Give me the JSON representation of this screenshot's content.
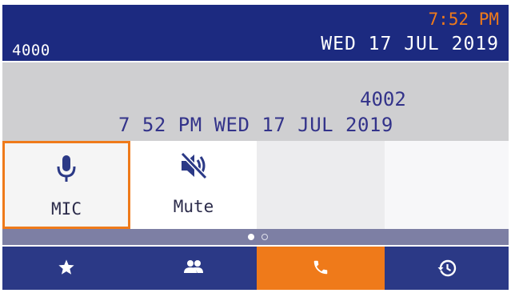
{
  "status_bar": {
    "extension": "4000",
    "time": "7:52 PM",
    "date": "WED 17 JUL 2019"
  },
  "call_info": {
    "remote_number": "4002",
    "call_time": "7 52 PM WED 17 JUL 2019"
  },
  "softkeys": [
    {
      "label": "MIC",
      "icon": "microphone-icon",
      "selected": true
    },
    {
      "label": "Mute",
      "icon": "speaker-muted-icon",
      "selected": false
    },
    {
      "label": "",
      "icon": "",
      "selected": false
    },
    {
      "label": "",
      "icon": "",
      "selected": false
    }
  ],
  "pager": {
    "pages": 2,
    "current": 1
  },
  "nav": [
    {
      "name": "favorites",
      "icon": "star-icon",
      "active": false
    },
    {
      "name": "contacts",
      "icon": "people-icon",
      "active": false
    },
    {
      "name": "call",
      "icon": "phone-icon",
      "active": true
    },
    {
      "name": "history",
      "icon": "history-icon",
      "active": false
    }
  ],
  "colors": {
    "status_bar_bg": "#1c2a80",
    "accent_orange": "#ef7a1a",
    "info_bg": "#cfcfd1",
    "text_blue": "#33338a",
    "nav_bg": "#2b3986",
    "pager_bg": "#7d7fa4"
  }
}
